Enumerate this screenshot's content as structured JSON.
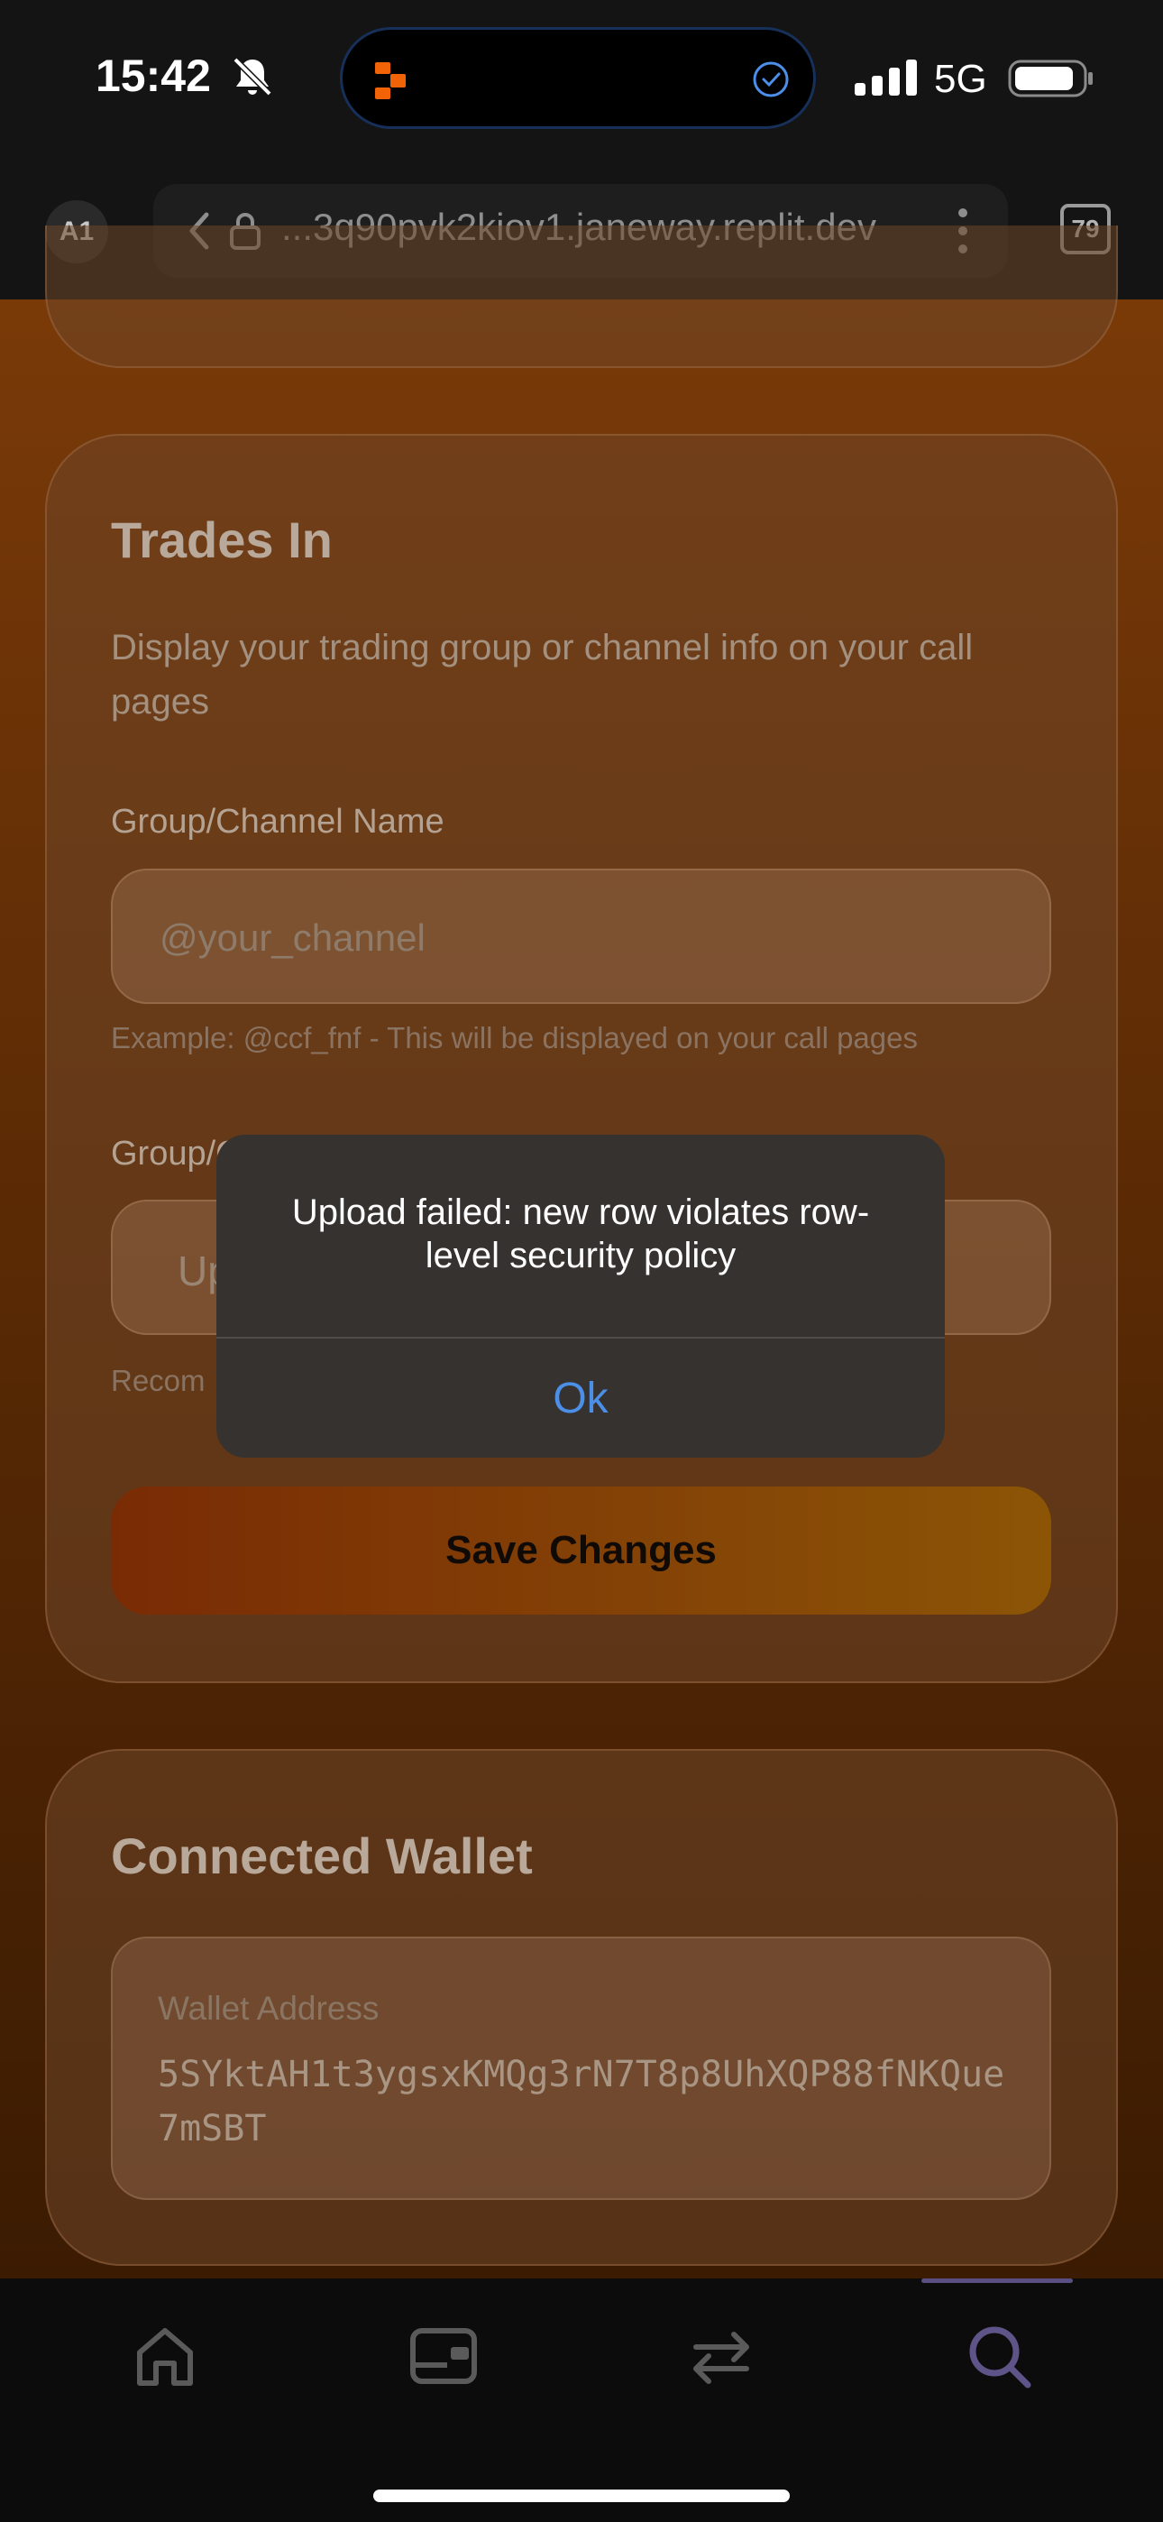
{
  "status_bar": {
    "time": "15:42",
    "network": "5G"
  },
  "browser": {
    "avatar": "A1",
    "url": "...3q90pvk2kiov1.janeway.replit.dev",
    "tab_count": "79"
  },
  "trades_in": {
    "title": "Trades In",
    "description": "Display your trading group or channel info on your call pages",
    "name_label": "Group/Channel Name",
    "name_placeholder": "@your_channel",
    "name_hint": "Example: @ccf_fnf - This will be displayed on your call pages",
    "image_label_partial": "Group/C",
    "upload_partial": "Up",
    "image_hint_partial": "Recom",
    "save_label": "Save Changes"
  },
  "wallet": {
    "title": "Connected Wallet",
    "address_label": "Wallet Address",
    "address": "5SYktAH1t3ygsxKMQg3rN7T8p8UhXQP88fNKQue7mSBT"
  },
  "dialog": {
    "message": "Upload failed: new row violates row-level security policy",
    "ok_label": "Ok"
  },
  "nav": {
    "active": "search",
    "items": [
      "home",
      "wallet-card",
      "swap",
      "search"
    ]
  },
  "colors": {
    "accent_blue": "#4c8fe6",
    "save_gradient_start": "#7a2b05",
    "save_gradient_end": "#8c5506"
  }
}
